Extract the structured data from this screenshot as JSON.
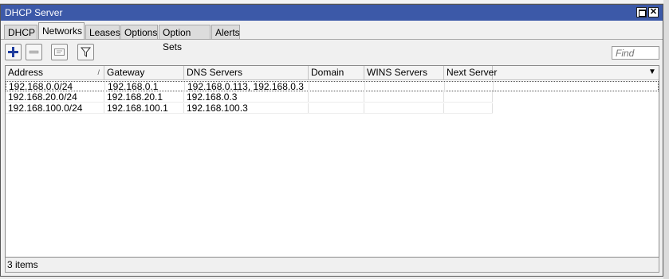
{
  "window": {
    "title": "DHCP Server"
  },
  "tabs": [
    {
      "label": "DHCP",
      "active": false
    },
    {
      "label": "Networks",
      "active": true
    },
    {
      "label": "Leases",
      "active": false
    },
    {
      "label": "Options",
      "active": false
    },
    {
      "label": "Option Sets",
      "active": false
    },
    {
      "label": "Alerts",
      "active": false
    }
  ],
  "toolbar": {
    "buttons": [
      "add-icon",
      "remove-icon",
      "comment-icon",
      "filter-icon"
    ],
    "find_placeholder": "Find"
  },
  "table": {
    "columns": [
      "Address",
      "Gateway",
      "DNS Servers",
      "Domain",
      "WINS Servers",
      "Next Server"
    ],
    "sorted_column": "Address",
    "rows": [
      [
        "192.168.0.0/24",
        "192.168.0.1",
        "192.168.0.113, 192.168.0.3",
        "",
        "",
        ""
      ],
      [
        "192.168.20.0/24",
        "192.168.20.1",
        "192.168.0.3",
        "",
        "",
        ""
      ],
      [
        "192.168.100.0/24",
        "192.168.100.1",
        "192.168.100.3",
        "",
        "",
        ""
      ]
    ]
  },
  "status": {
    "item_count": "3 items"
  },
  "colors": {
    "titlebar": "#3c59a8",
    "add_icon": "#1f3d9e"
  }
}
